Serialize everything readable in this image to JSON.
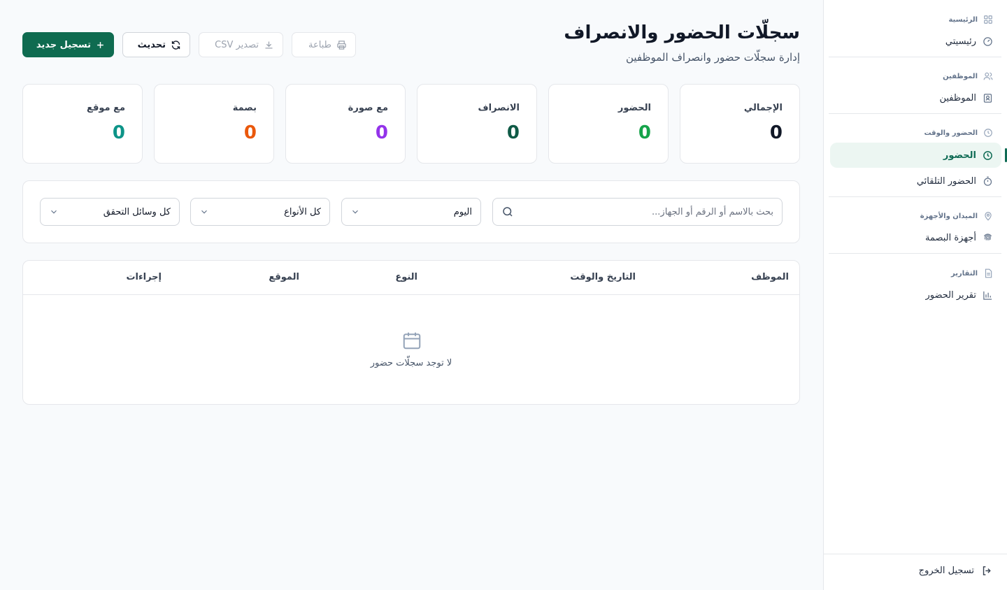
{
  "page": {
    "title": "سجلّات الحضور والانصراف",
    "subtitle": "إدارة سجلّات حضور وانصراف الموظفين"
  },
  "toolbar": {
    "new_label": "تسجيل جديد",
    "refresh_label": "تحديث",
    "export_label": "تصدير CSV",
    "print_label": "طباعة"
  },
  "stats": [
    {
      "label": "الإجمالي",
      "value": "0",
      "color": "#111827"
    },
    {
      "label": "الحضور",
      "value": "0",
      "color": "#16a34a"
    },
    {
      "label": "الانصراف",
      "value": "0",
      "color": "#0f5a46"
    },
    {
      "label": "مع صورة",
      "value": "0",
      "color": "#9333ea"
    },
    {
      "label": "بصمة",
      "value": "0",
      "color": "#ea580c"
    },
    {
      "label": "مع موقع",
      "value": "0",
      "color": "#0d9488"
    }
  ],
  "filters": {
    "search_placeholder": "بحث بالاسم أو الرقم أو الجهاز...",
    "date_value": "اليوم",
    "type_value": "كل الأنواع",
    "method_value": "كل وسائل التحقق"
  },
  "table": {
    "columns": [
      "الموظف",
      "التاريخ والوقت",
      "النوع",
      "الموقع",
      "إجراءات"
    ],
    "empty_text": "لا توجد سجلّات حضور"
  },
  "sidebar": {
    "sections": [
      {
        "heading": "الرئيسية",
        "items": [
          {
            "label": "رئيسيتي"
          }
        ]
      },
      {
        "heading": "الموظفين",
        "items": [
          {
            "label": "الموظفين"
          }
        ]
      },
      {
        "heading": "الحضور والوقت",
        "items": [
          {
            "label": "الحضور"
          },
          {
            "label": "الحضور التلقائي"
          }
        ]
      },
      {
        "heading": "الميدان والأجهزة",
        "items": [
          {
            "label": "أجهزة البصمة"
          }
        ]
      },
      {
        "heading": "التقارير",
        "items": [
          {
            "label": "تقرير الحضور"
          }
        ]
      }
    ],
    "logout_label": "تسجيل الخروج"
  },
  "colors": {
    "accent": "#0f6b50",
    "active_bg": "#ecf6f2"
  }
}
